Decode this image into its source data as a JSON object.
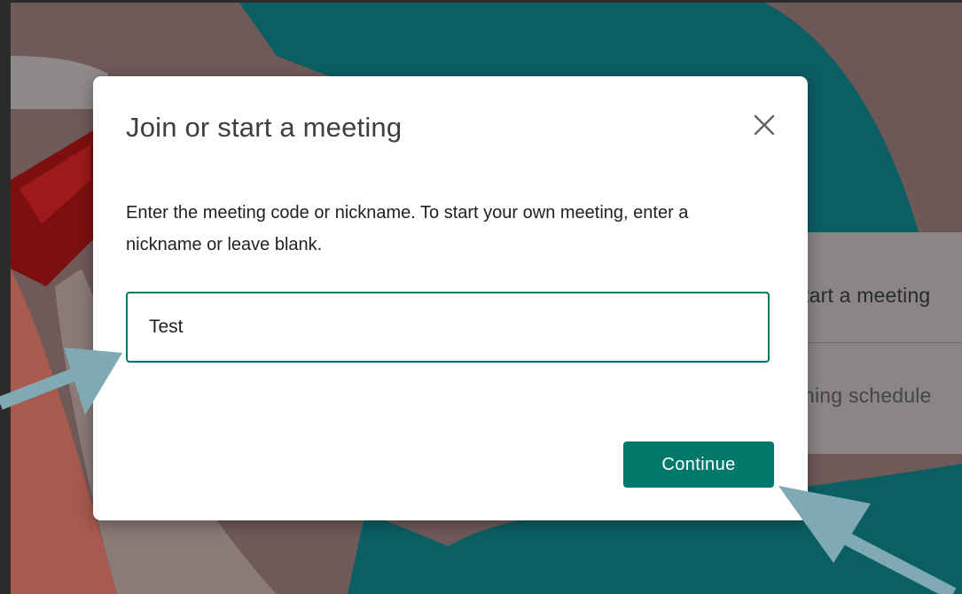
{
  "dialog": {
    "title": "Join or start a meeting",
    "description": "Enter the meeting code or nickname. To start your own meeting, enter a nickname or leave blank.",
    "input_value": "Test",
    "continue_label": "Continue",
    "close_icon": "close-icon"
  },
  "background_card": {
    "row1_text": "tart a meeting",
    "row2_text": "hing schedule"
  },
  "colors": {
    "accent": "#00796b",
    "arrow": "#7fa9b3",
    "backdrop": "#6f5a5a",
    "teal_shape": "#0b5f63"
  }
}
